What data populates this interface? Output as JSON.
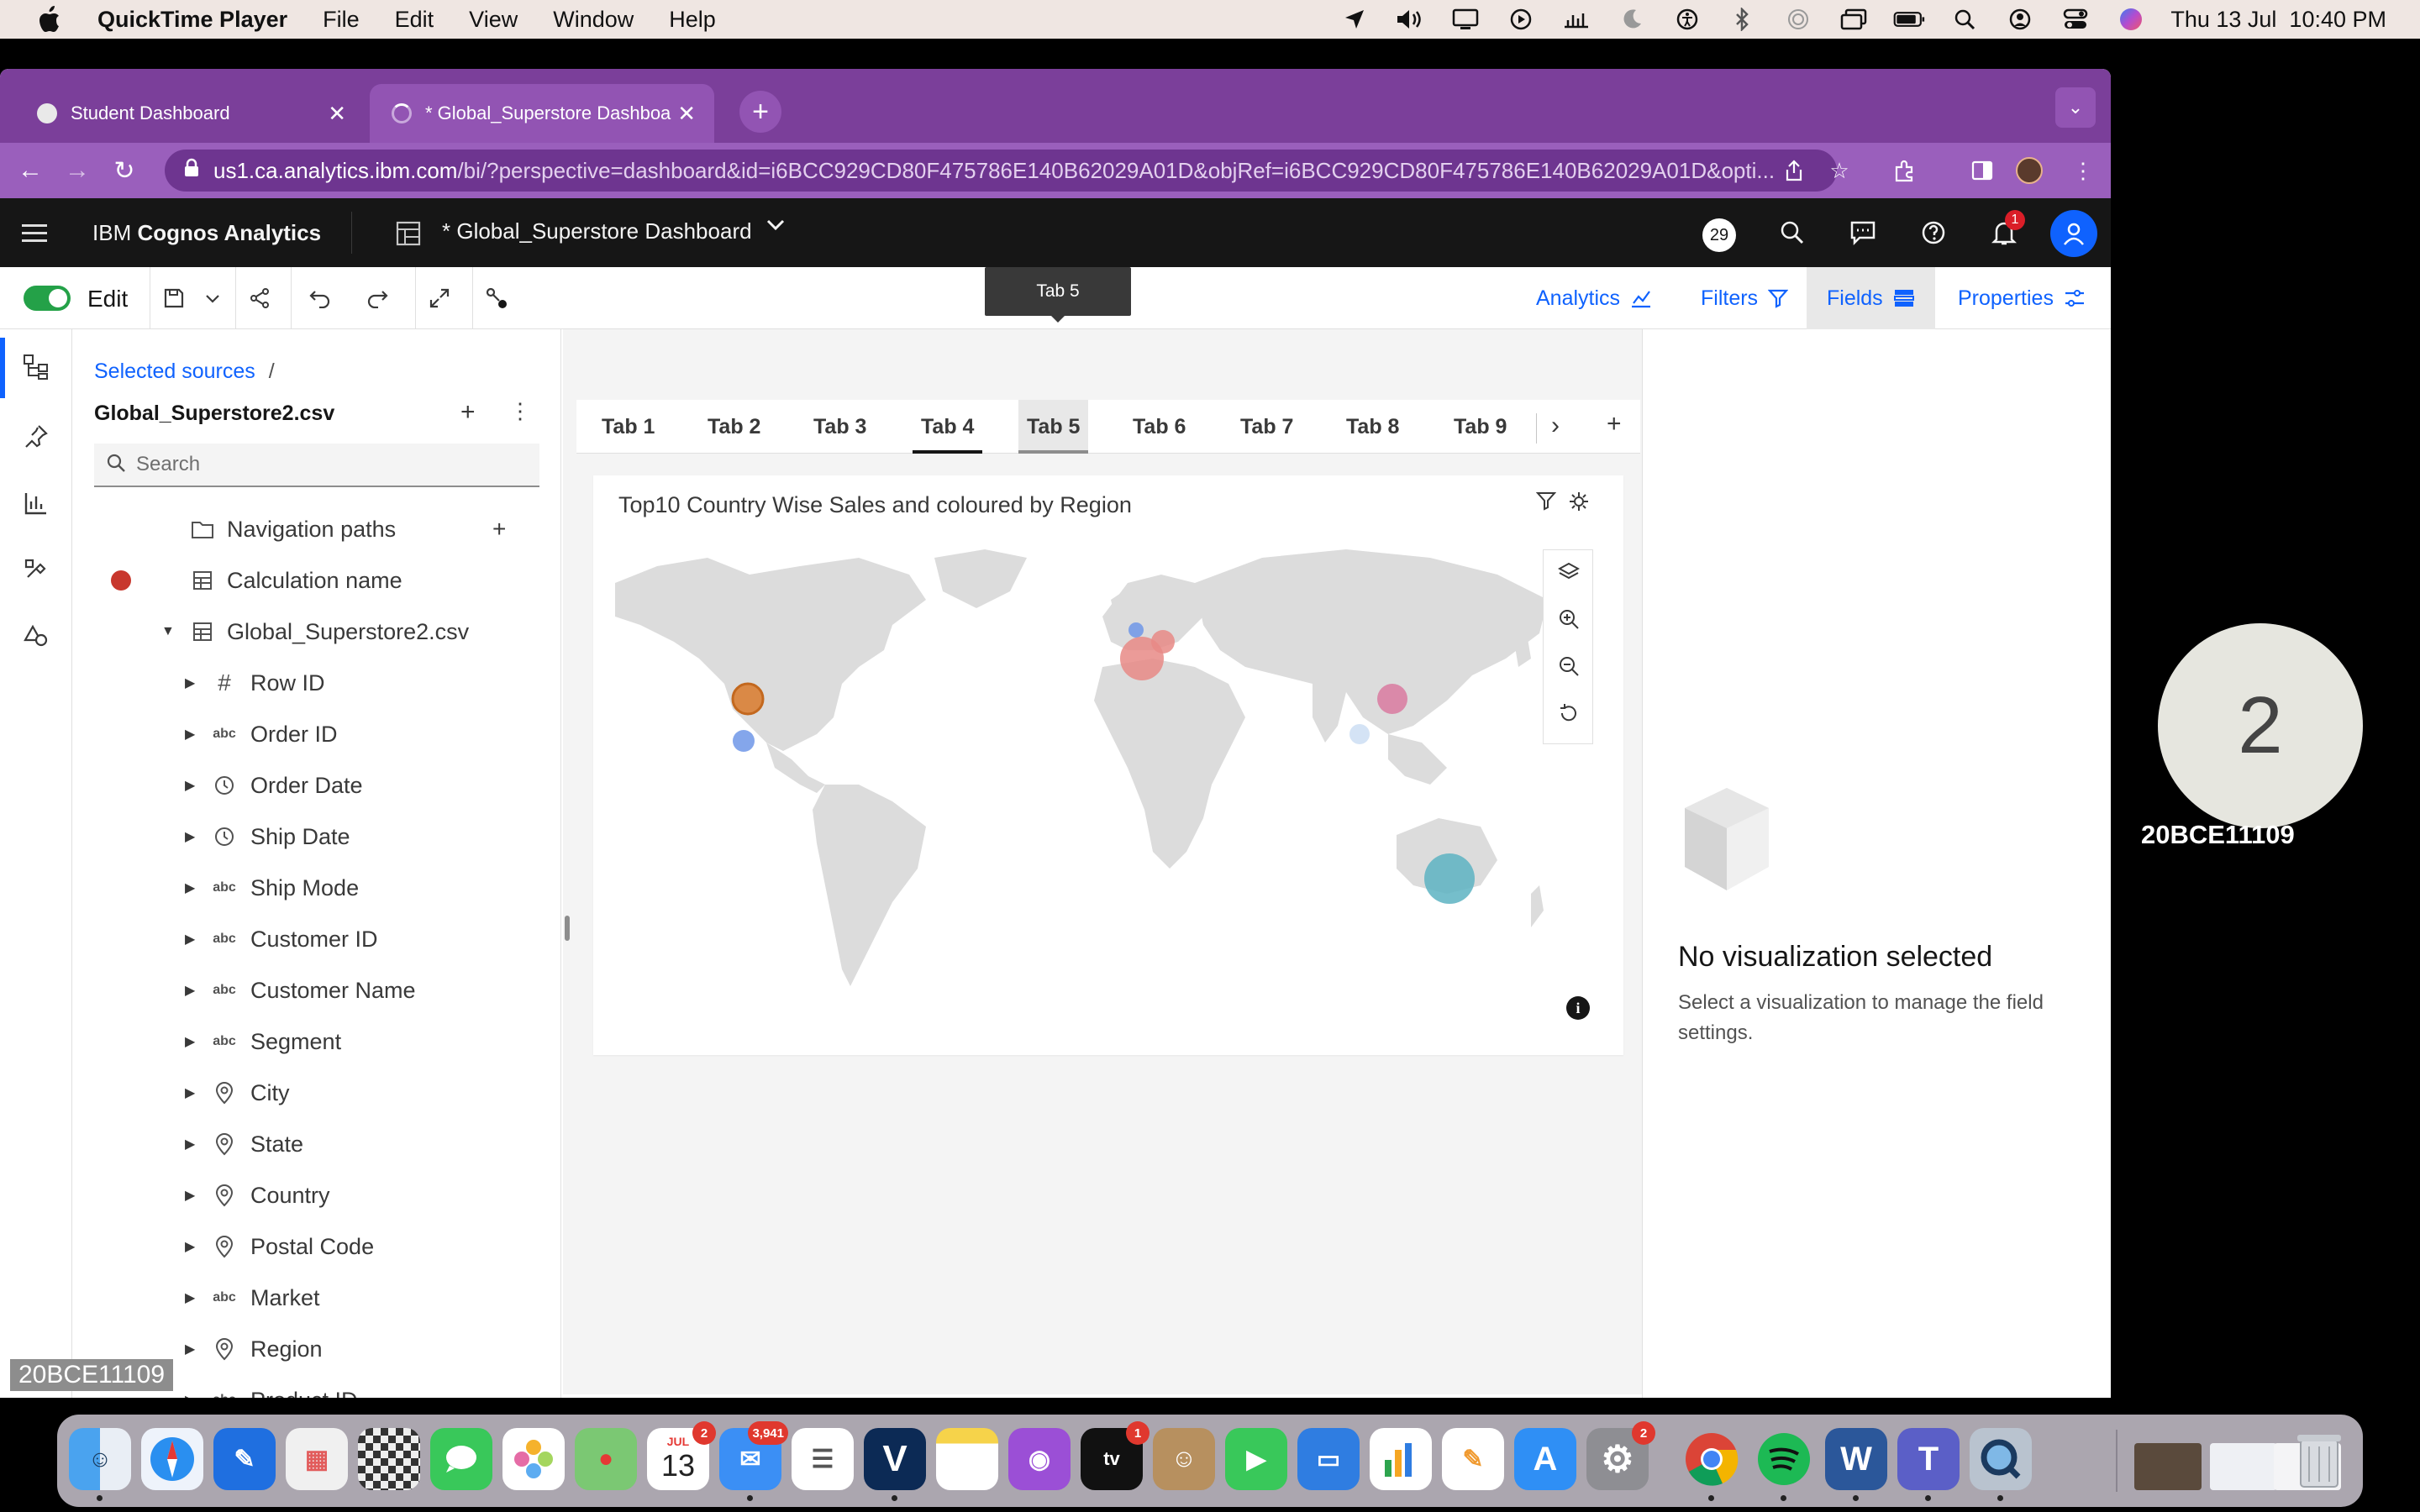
{
  "menubar": {
    "app_name": "QuickTime Player",
    "menus": [
      "File",
      "Edit",
      "View",
      "Window",
      "Help"
    ],
    "datetime": "Thu 13 Jul  10:40 PM"
  },
  "video_tile": {
    "number": "2",
    "name": "20BCE11109"
  },
  "browser": {
    "tabs": [
      {
        "title": "Student Dashboard"
      },
      {
        "title": "* Global_Superstore Dashboa"
      }
    ],
    "url_host": "us1.ca.analytics.ibm.com",
    "url_path": "/bi/?perspective=dashboard&id=i6BCC929CD80F475786E140B62029A01D&objRef=i6BCC929CD80F475786E140B62029A01D&opti..."
  },
  "cognos": {
    "brand_prefix": "IBM ",
    "brand_name": "Cognos Analytics",
    "dashboard_title": "* Global_Superstore Dashboard",
    "badge_count": "29",
    "notification_count": "1"
  },
  "edit_toolbar": {
    "edit_label": "Edit",
    "tooltip": "Tab 5",
    "right_tabs": [
      "Analytics",
      "Filters",
      "Fields",
      "Properties"
    ]
  },
  "sources": {
    "breadcrumb": "Selected sources",
    "breadcrumb_sep": "/",
    "source_name": "Global_Superstore2.csv",
    "search_placeholder": "Search",
    "tree": [
      {
        "label": "Navigation paths",
        "icon": "folder-icon"
      },
      {
        "label": "Calculation name",
        "icon": "table-icon"
      },
      {
        "label": "Global_Superstore2.csv",
        "icon": "table-icon"
      },
      {
        "label": "Row ID",
        "icon": "#"
      },
      {
        "label": "Order ID",
        "icon": "abc"
      },
      {
        "label": "Order Date",
        "icon": "clock-icon"
      },
      {
        "label": "Ship Date",
        "icon": "clock-icon"
      },
      {
        "label": "Ship Mode",
        "icon": "abc"
      },
      {
        "label": "Customer ID",
        "icon": "abc"
      },
      {
        "label": "Customer Name",
        "icon": "abc"
      },
      {
        "label": "Segment",
        "icon": "abc"
      },
      {
        "label": "City",
        "icon": "location-icon"
      },
      {
        "label": "State",
        "icon": "location-icon"
      },
      {
        "label": "Country",
        "icon": "location-icon"
      },
      {
        "label": "Postal Code",
        "icon": "location-icon"
      },
      {
        "label": "Market",
        "icon": "abc"
      },
      {
        "label": "Region",
        "icon": "location-icon"
      },
      {
        "label": "Product ID",
        "icon": "abc"
      }
    ]
  },
  "canvas": {
    "tabs": [
      "Tab 1",
      "Tab 2",
      "Tab 3",
      "Tab 4",
      "Tab 5",
      "Tab 6",
      "Tab 7",
      "Tab 8",
      "Tab 9"
    ],
    "active_tab": "Tab 4",
    "hover_tab": "Tab 5",
    "viz_title": "Top10 Country Wise Sales and coloured by Region"
  },
  "properties_panel": {
    "heading": "No visualization selected",
    "subtext": "Select a visualization to manage the field settings."
  },
  "watermark": "20BCE11109",
  "dock": {
    "calendar_month": "JUL",
    "calendar_day": "13",
    "badges": {
      "calendar": "2",
      "mail": "3,941",
      "tv": "1",
      "settings": "2"
    }
  },
  "colors": {
    "tab_purple": "#7b3f9a",
    "cognos_blue": "#0f62fe",
    "header_black": "#161616",
    "toggle_green": "#24a148"
  }
}
